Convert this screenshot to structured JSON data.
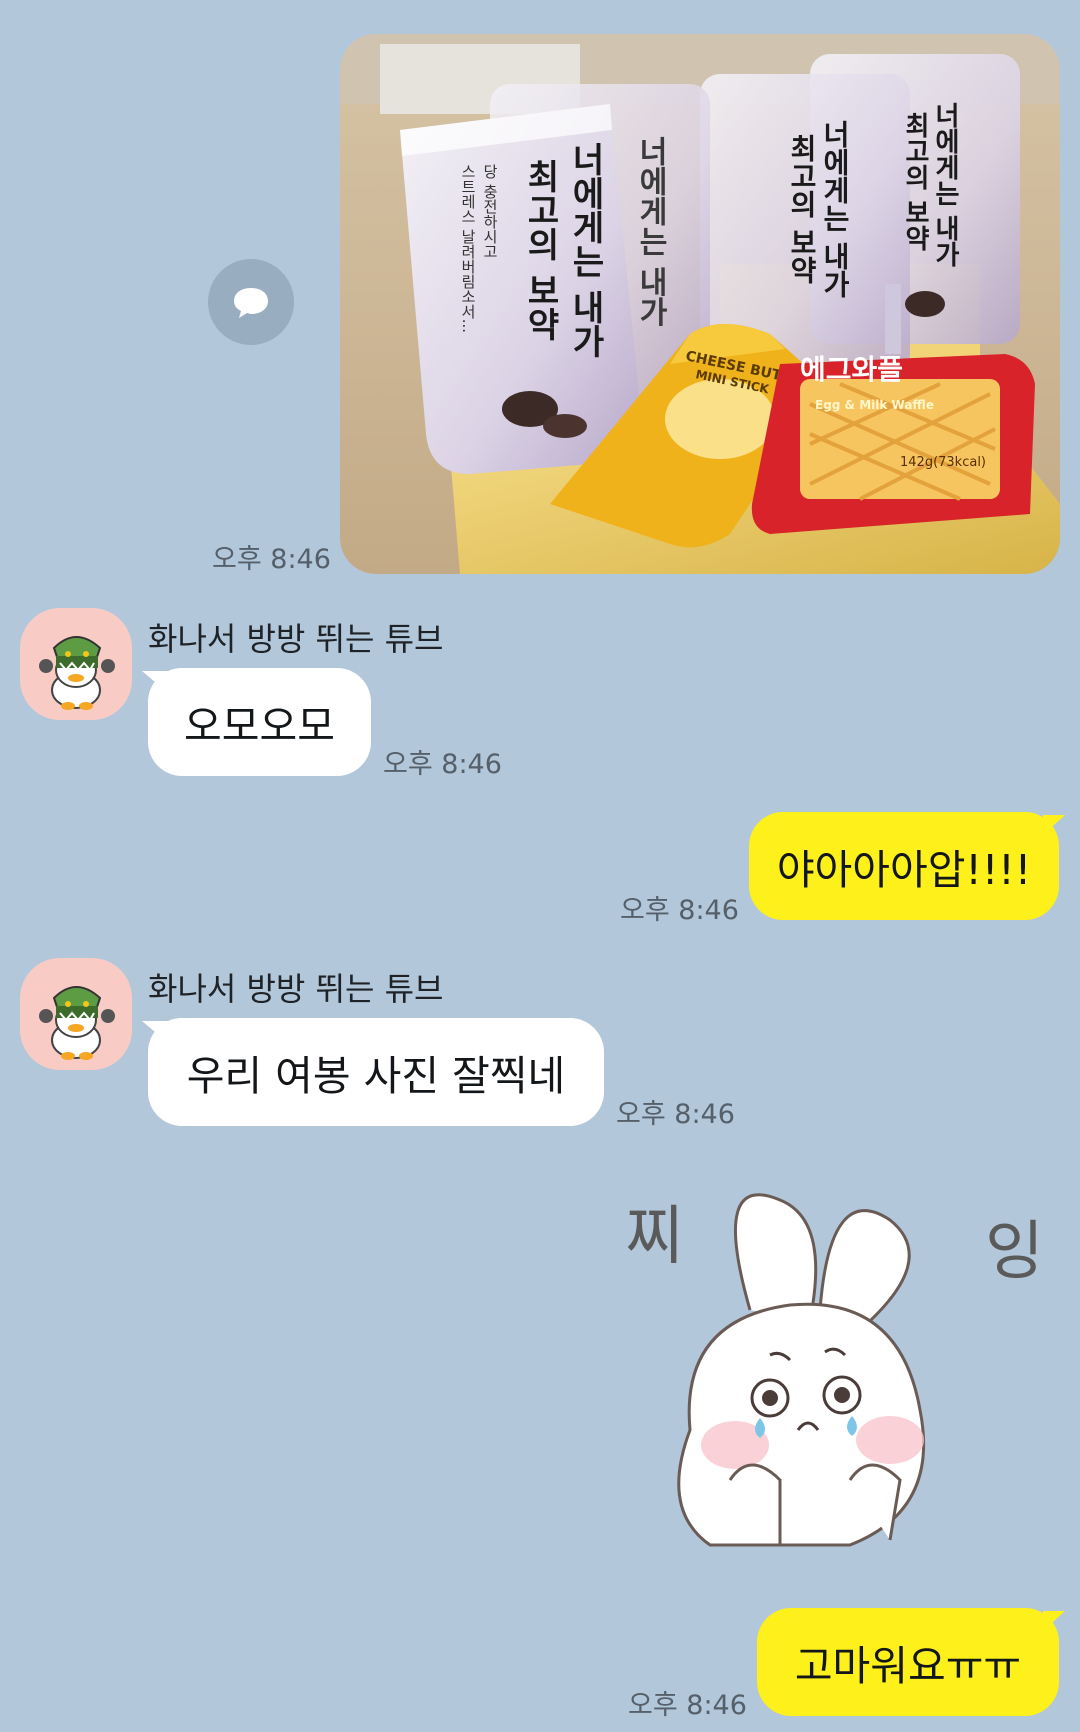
{
  "messages": {
    "photo_time": "오후 8:46",
    "msg1": {
      "sender": "화나서 방방 뛰는 튜브",
      "text": "오모오모",
      "time": "오후 8:46"
    },
    "msg2": {
      "text": "야아아아압!!!!",
      "time": "오후 8:46"
    },
    "msg3": {
      "sender": "화나서 방방 뛰는 튜브",
      "text": "우리 여봉 사진 잘찍네",
      "time": "오후 8:46"
    },
    "sticker_text": {
      "left": "찌",
      "right": "잉"
    },
    "msg4": {
      "text": "고마워요ㅠㅠ",
      "time": "오후 8:46"
    }
  },
  "photo": {
    "pouch_line1": "너에게는 내가",
    "pouch_line2": "최고의 보약",
    "pouch_small1": "당 충전하시고",
    "pouch_small2": "스트레스 날려버림소서...",
    "snack1_name": "CHEESE BUTTER",
    "snack1_sub": "MINI STICK",
    "snack2_name": "에그와플",
    "snack2_sub": "Egg & Milk Waffle",
    "snack2_kcal": "142g(73kcal)"
  },
  "icons": {
    "share": "chat-bubble-icon",
    "avatar": "tube-character-avatar",
    "sticker": "crying-bunny-sticker"
  },
  "colors": {
    "background": "#b2c7da",
    "incoming_bubble": "#ffffff",
    "outgoing_bubble": "#fef01b",
    "avatar_bg": "#f8ccc4"
  }
}
